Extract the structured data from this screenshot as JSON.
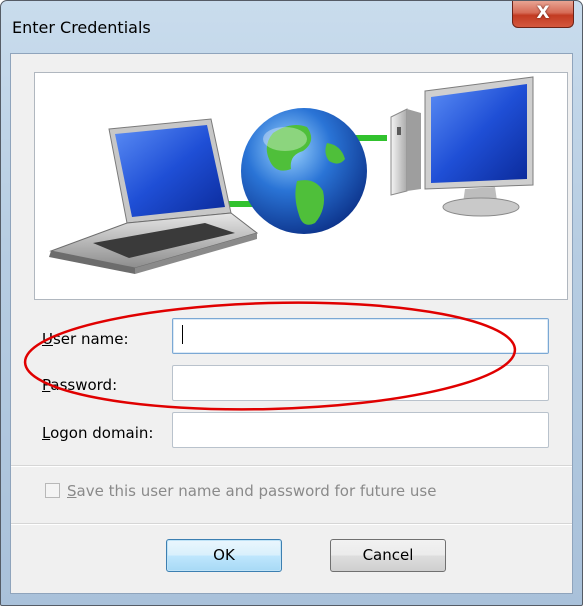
{
  "window": {
    "title": "Enter Credentials",
    "close_glyph": "X"
  },
  "banner": {
    "icons": [
      "laptop-icon",
      "globe-icon",
      "desktop-computer-icon"
    ]
  },
  "form": {
    "user_name": {
      "label_accel": "U",
      "label_rest": "ser name:",
      "value": ""
    },
    "password": {
      "label_accel": "P",
      "label_rest": "assword:",
      "value": ""
    },
    "logon_domain": {
      "label_accel": "L",
      "label_rest": "ogon domain:",
      "value": ""
    }
  },
  "save_option": {
    "label_accel": "S",
    "label_rest": "ave this user name and password for future use",
    "checked": false,
    "enabled": false
  },
  "buttons": {
    "ok": "OK",
    "cancel": "Cancel"
  },
  "annotation": {
    "shape": "ellipse",
    "color": "#e00000"
  }
}
